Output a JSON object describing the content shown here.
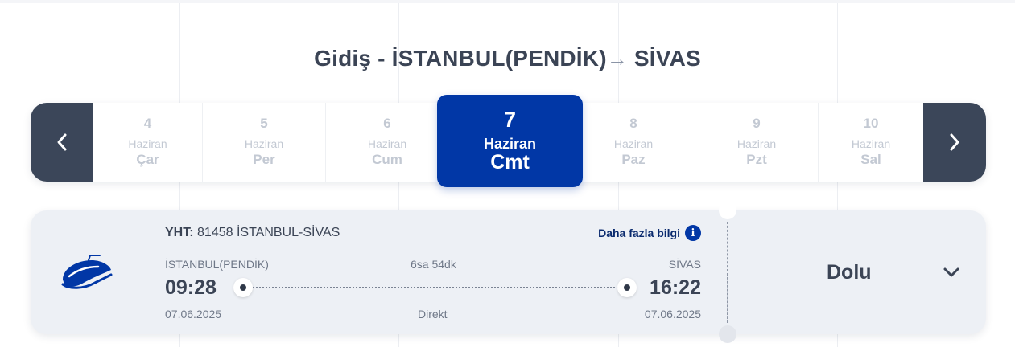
{
  "header": {
    "direction_label": "Gidiş -",
    "origin": "İSTANBUL(PENDİK)",
    "arrow": "→",
    "destination": "SİVAS"
  },
  "date_nav": {
    "prev_icon": "chevron-left-icon",
    "next_icon": "chevron-right-icon",
    "days": [
      {
        "num": "4",
        "month": "Haziran",
        "weekday": "Çar"
      },
      {
        "num": "5",
        "month": "Haziran",
        "weekday": "Per"
      },
      {
        "num": "6",
        "month": "Haziran",
        "weekday": "Cum"
      },
      {
        "num": "7",
        "month": "Haziran",
        "weekday": "Cmt",
        "selected": true
      },
      {
        "num": "8",
        "month": "Haziran",
        "weekday": "Paz"
      },
      {
        "num": "9",
        "month": "Haziran",
        "weekday": "Pzt"
      },
      {
        "num": "10",
        "month": "Haziran",
        "weekday": "Sal"
      }
    ]
  },
  "trip": {
    "train_icon": "high-speed-train-icon",
    "type": "YHT:",
    "line": "81458 İSTANBUL-SİVAS",
    "more_info": "Daha fazla bilgi",
    "info_icon_glyph": "i",
    "departure_station": "İSTANBUL(PENDİK)",
    "arrival_station": "SİVAS",
    "duration": "6sa 54dk",
    "departure_time": "09:28",
    "arrival_time": "16:22",
    "departure_date": "07.06.2025",
    "arrival_date": "07.06.2025",
    "route_type": "Direkt",
    "status": "Dolu",
    "expand_icon": "chevron-down-icon"
  },
  "colors": {
    "accent": "#0137a6",
    "nav_button": "#3b4659",
    "card_bg": "#edf0f5",
    "text": "#3b4455",
    "muted": "#c3c9d3"
  }
}
